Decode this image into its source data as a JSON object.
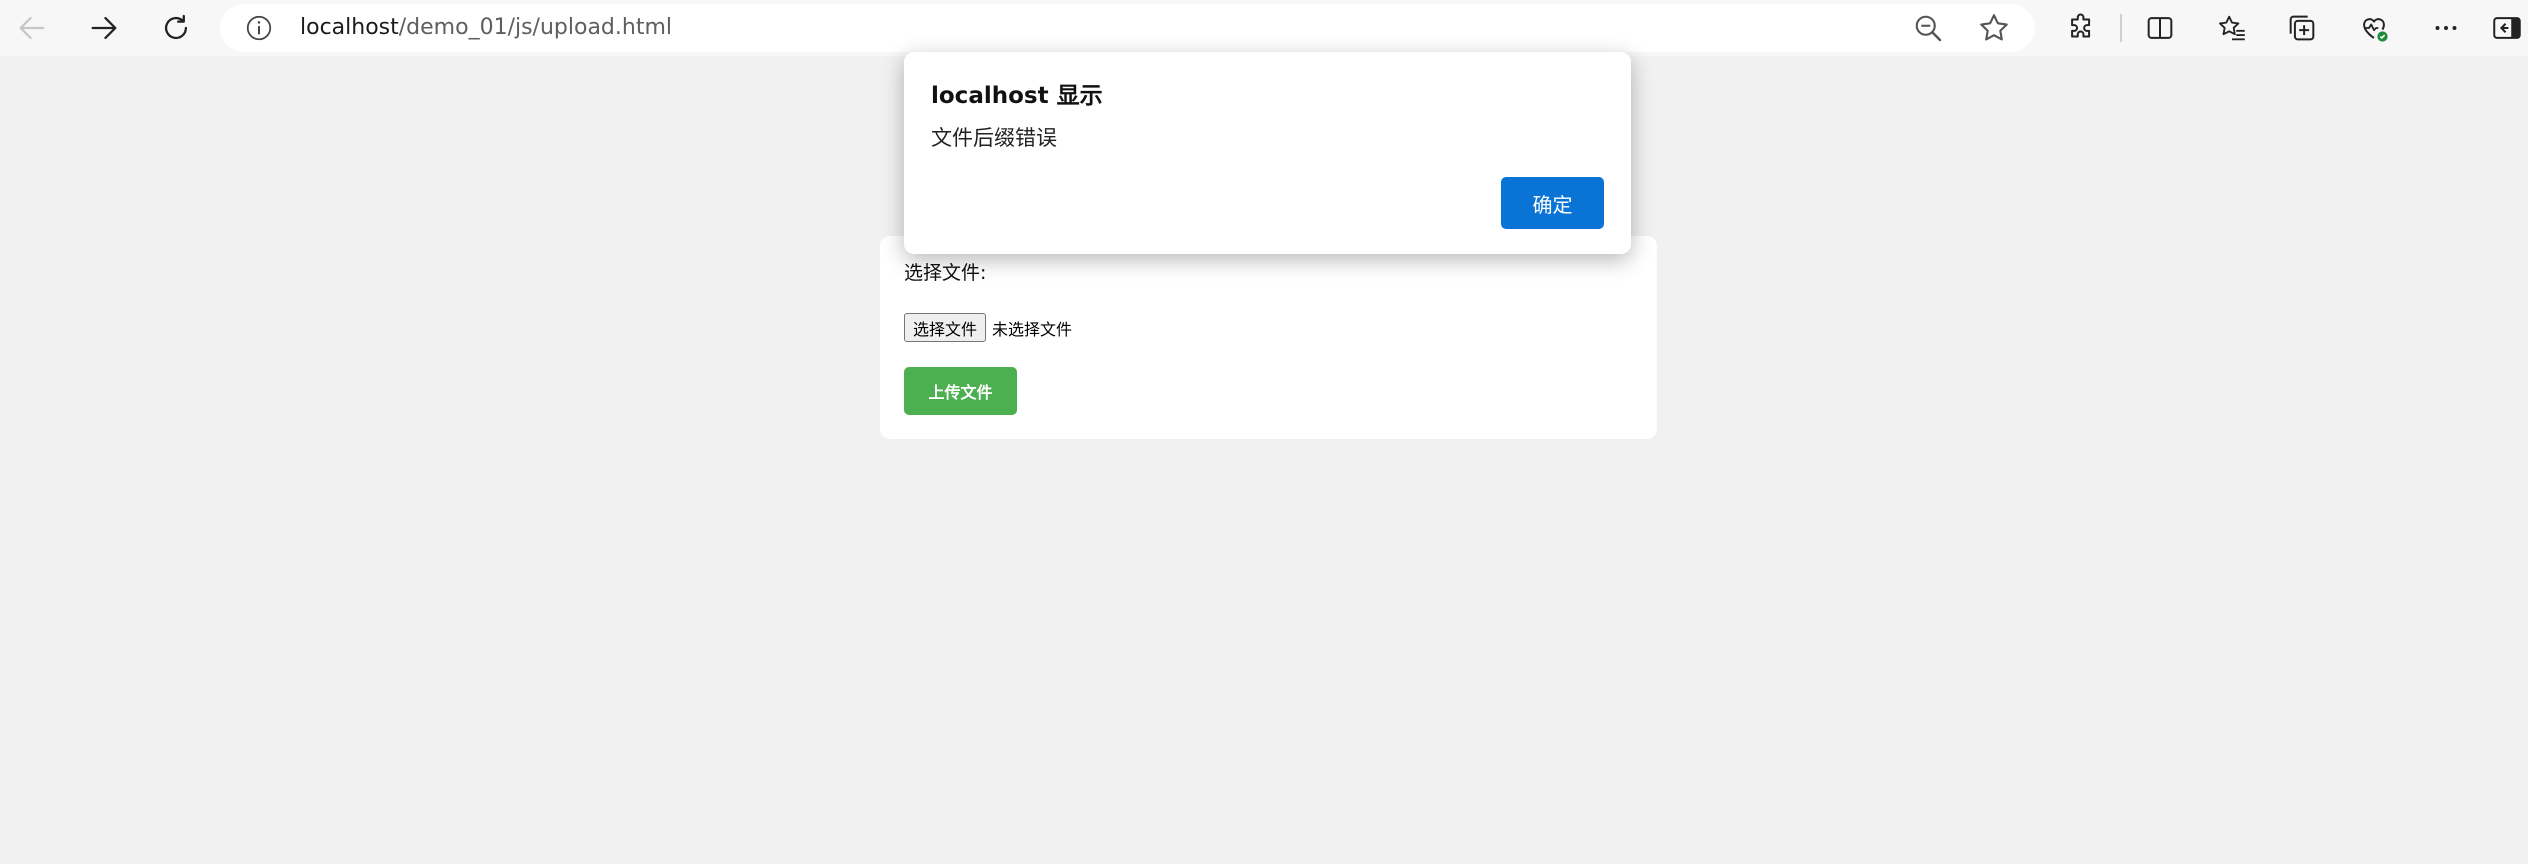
{
  "browser": {
    "url_host": "localhost",
    "url_path": "/demo_01/js/upload.html"
  },
  "page": {
    "label": "选择文件:",
    "file_button": "选择文件",
    "file_status": "未选择文件",
    "upload_button": "上传文件",
    "upload_color": "#4caf50"
  },
  "dialog": {
    "title": "localhost 显示",
    "message": "文件后缀错误",
    "ok_label": "确定",
    "ok_color": "#0a74d6"
  },
  "icons": {
    "back": "arrow-left-icon",
    "forward": "arrow-right-icon",
    "refresh": "refresh-icon",
    "info": "info-icon",
    "zoom": "zoom-out-icon",
    "favorite": "star-icon",
    "extensions": "puzzle-icon",
    "split": "split-screen-icon",
    "favorites": "favorites-list-icon",
    "collections": "collections-icon",
    "health": "browser-essentials-icon",
    "more": "more-icon",
    "sidebar": "sidebar-toggle-icon"
  }
}
